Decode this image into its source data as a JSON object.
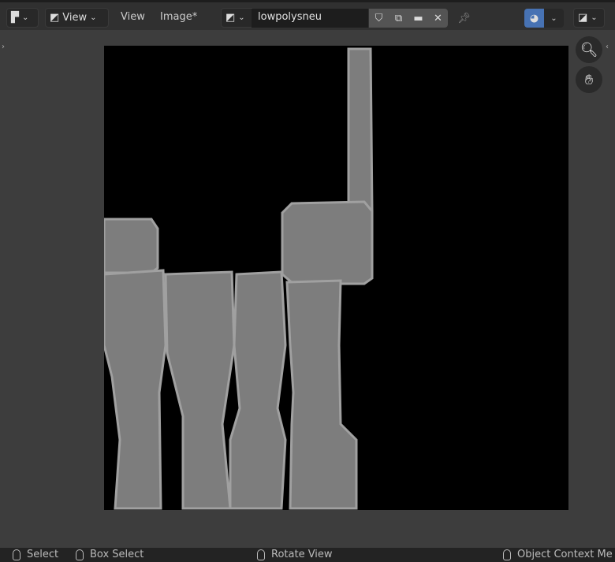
{
  "header": {
    "editor_type_icon": "image-editor-icon",
    "view_mode": "View",
    "menus": [
      "View",
      "Image*"
    ],
    "image_browse_icon": "image-icon",
    "image_name": "lowpolysneu",
    "icons": [
      "fake-user-shield-icon",
      "duplicate-icon",
      "open-folder-icon",
      "close-icon",
      "pin-icon",
      "overlay-icon",
      "display-channels-icon"
    ],
    "accent": "#4772b3"
  },
  "tools": [
    "zoom-icon",
    "hand-pan-icon"
  ],
  "status": {
    "items": [
      "Select",
      "Box Select",
      "Rotate View",
      "Object Context Me"
    ]
  }
}
